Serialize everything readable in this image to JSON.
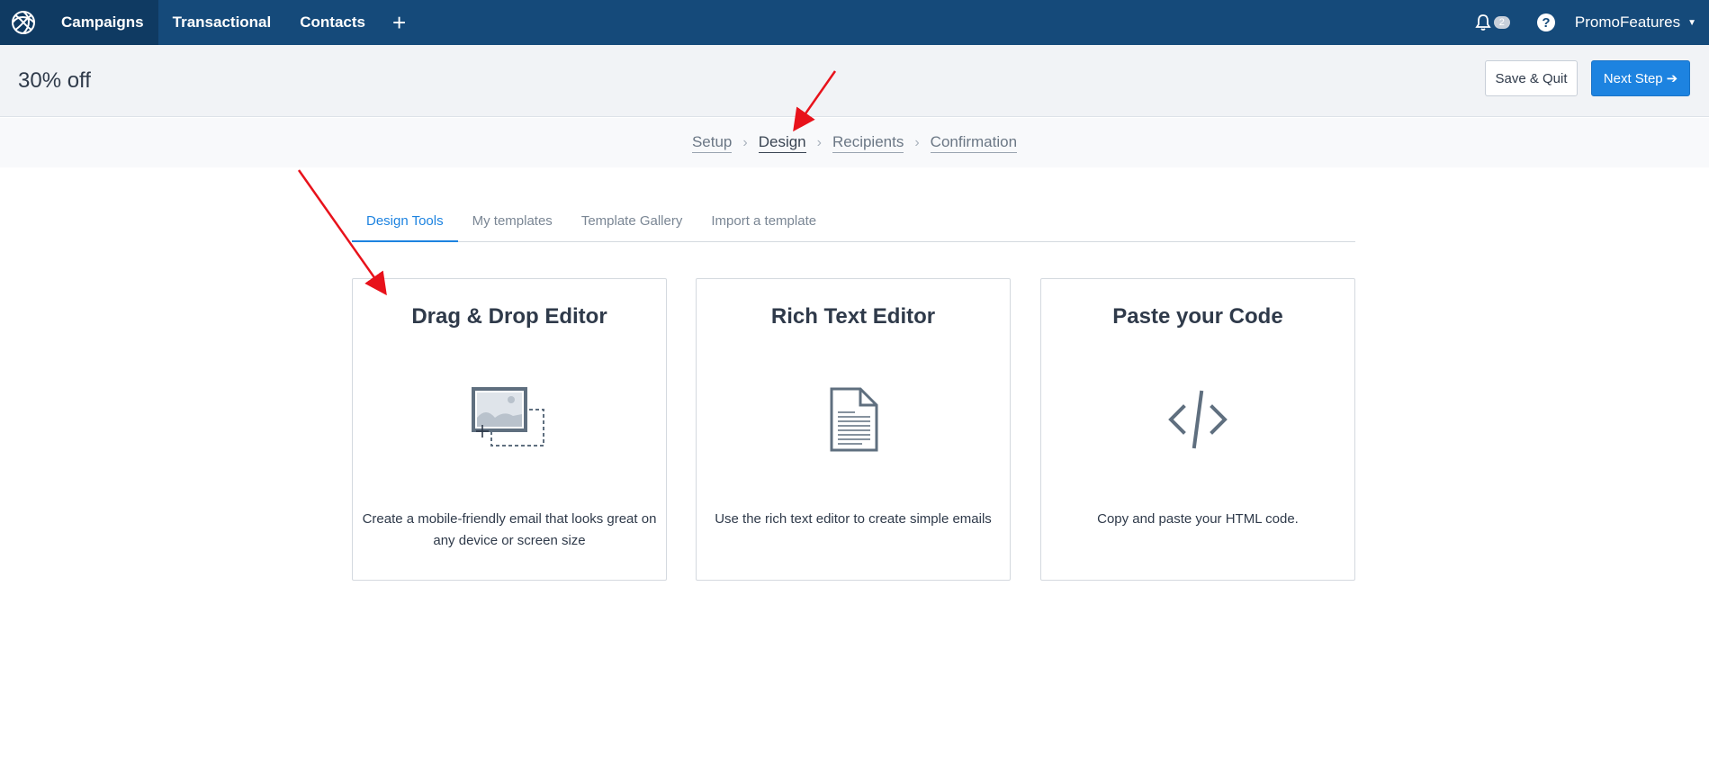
{
  "nav": {
    "items": [
      {
        "label": "Campaigns",
        "active": true
      },
      {
        "label": "Transactional",
        "active": false
      },
      {
        "label": "Contacts",
        "active": false
      }
    ],
    "plus": "+",
    "notifications_count": "2",
    "help": "?",
    "account_name": "PromoFeatures",
    "account_caret": "▼"
  },
  "header": {
    "title": "30% off",
    "save_label": "Save & Quit",
    "next_label": "Next Step",
    "next_icon": "➔"
  },
  "steps": [
    {
      "label": "Setup",
      "current": false
    },
    {
      "label": "Design",
      "current": true
    },
    {
      "label": "Recipients",
      "current": false
    },
    {
      "label": "Confirmation",
      "current": false
    }
  ],
  "step_separator": "›",
  "tabs": [
    {
      "label": "Design Tools",
      "active": true
    },
    {
      "label": "My templates",
      "active": false
    },
    {
      "label": "Template Gallery",
      "active": false
    },
    {
      "label": "Import a template",
      "active": false
    }
  ],
  "cards": [
    {
      "title": "Drag & Drop Editor",
      "icon": "drag-drop-image-icon",
      "description": "Create a mobile-friendly email that looks great on any device or screen size"
    },
    {
      "title": "Rich Text Editor",
      "icon": "document-icon",
      "description": "Use the rich text editor to create simple emails"
    },
    {
      "title": "Paste your Code",
      "icon": "code-icon",
      "description": "Copy and paste your HTML code."
    }
  ],
  "colors": {
    "nav_bg": "#154a7a",
    "nav_active_bg": "#0f3a62",
    "primary": "#1d83e0",
    "annotation_arrow": "#e8121b",
    "icon_gray": "#5f6f7f"
  }
}
